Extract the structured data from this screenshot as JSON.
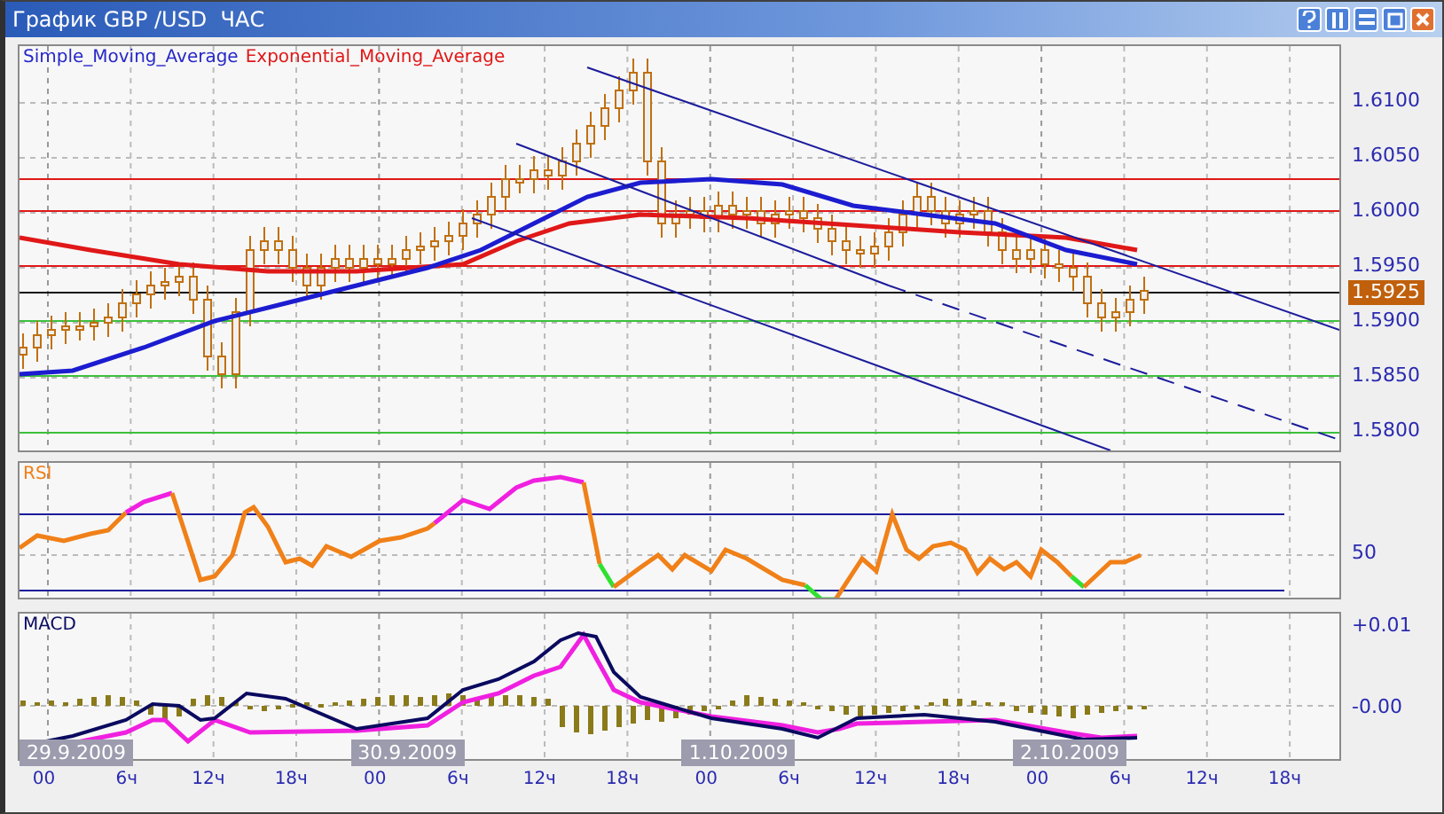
{
  "window": {
    "title": "График GBP /USD  ЧАС"
  },
  "price_panel": {
    "legend": [
      {
        "text": "Simple_Moving_Average",
        "color": "#2828c8"
      },
      {
        "text": "Exponential_Moving_Average",
        "color": "#e01818"
      }
    ],
    "axis_labels": [
      "1.6100",
      "1.6050",
      "1.6000",
      "1.5950",
      "1.5900",
      "1.5850",
      "1.5800"
    ],
    "current_price": "1.5925"
  },
  "rsi_panel": {
    "label": "RSI",
    "axis_labels": [
      "50"
    ]
  },
  "macd_panel": {
    "label": "MACD",
    "axis_labels": [
      "+0.01",
      "-0.00"
    ]
  },
  "time_axis": {
    "dates": [
      "29.9.2009",
      "30.9.2009",
      "1.10.2009",
      "2.10.2009"
    ],
    "hours": [
      "00",
      "6ч",
      "12ч",
      "18ч",
      "00",
      "6ч",
      "12ч",
      "18ч",
      "00",
      "6ч",
      "12ч",
      "18ч",
      "00",
      "6ч",
      "12ч",
      "18ч"
    ]
  }
}
